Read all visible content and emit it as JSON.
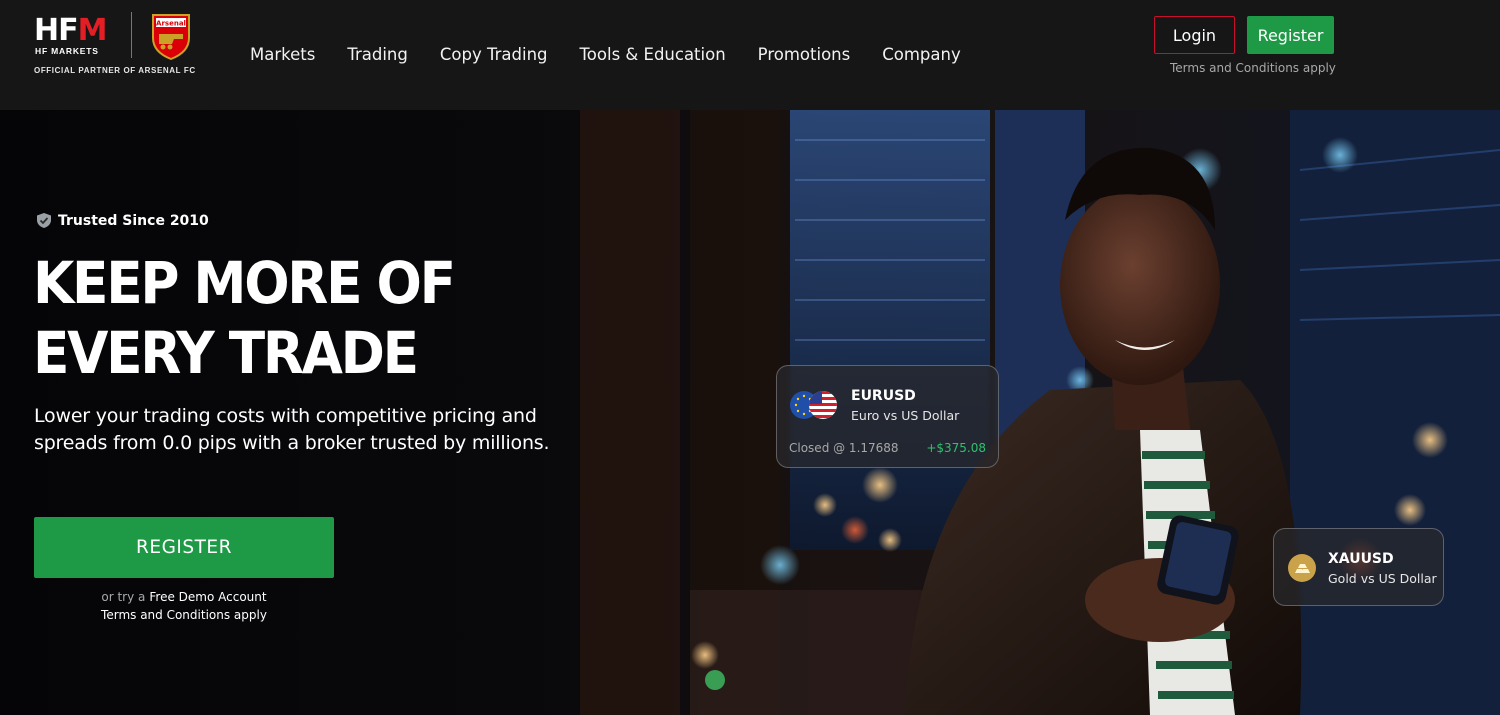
{
  "brand": {
    "logo_main": "HF",
    "logo_m": "M",
    "logo_sub": "HF MARKETS",
    "partner_text": "OFFICIAL PARTNER OF ARSENAL FC",
    "crest_text": "Arsenal"
  },
  "nav": {
    "items": [
      {
        "label": "Markets"
      },
      {
        "label": "Trading"
      },
      {
        "label": "Copy Trading"
      },
      {
        "label": "Tools & Education"
      },
      {
        "label": "Promotions"
      },
      {
        "label": "Company"
      }
    ]
  },
  "header_actions": {
    "login_label": "Login",
    "register_label": "Register",
    "terms_text": "Terms and Conditions apply"
  },
  "hero": {
    "badge_text": "Trusted Since 2010",
    "headline_line1": "KEEP MORE OF",
    "headline_line2": "EVERY TRADE",
    "subhead_line1": "Lower your trading costs with competitive pricing and",
    "subhead_line2": "spreads from 0.0 pips with a broker trusted by millions.",
    "register_label": "REGISTER",
    "demo_prefix": "or try a",
    "demo_link": "Free Demo Account",
    "terms_text": "Terms and Conditions apply"
  },
  "cards": {
    "eurusd": {
      "symbol": "EURUSD",
      "name": "Euro vs US Dollar",
      "status": "Closed @ 1.17688",
      "profit": "+$375.08"
    },
    "xauusd": {
      "symbol": "XAUUSD",
      "name": "Gold vs US Dollar"
    }
  },
  "colors": {
    "accent_green": "#1e9a47",
    "brand_red": "#c8102e",
    "profit_green": "#2fc26a",
    "header_bg": "#161616"
  }
}
